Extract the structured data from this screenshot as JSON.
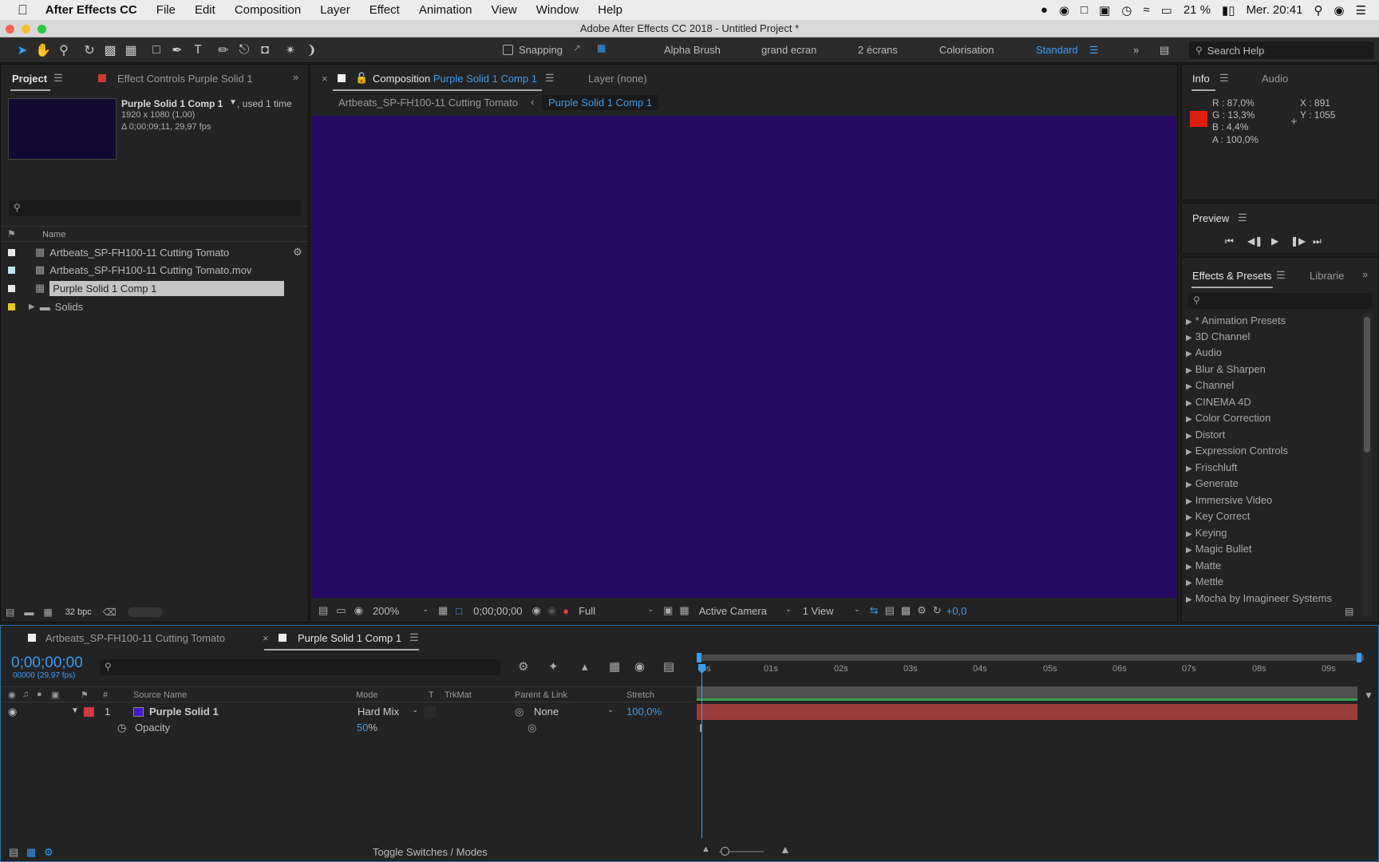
{
  "menubar": {
    "apple": "",
    "app_name": "After Effects CC",
    "items": [
      "File",
      "Edit",
      "Composition",
      "Layer",
      "Effect",
      "Animation",
      "View",
      "Window",
      "Help"
    ],
    "battery": "21 %",
    "clock": "Mer. 20:41"
  },
  "window_title": "Adobe After Effects CC 2018 - Untitled Project *",
  "toolbar": {
    "snapping_label": "Snapping",
    "workspaces": [
      "Alpha Brush",
      "grand ecran",
      "2 écrans",
      "Colorisation",
      "Standard"
    ],
    "search_placeholder": "Search Help"
  },
  "project_panel": {
    "tab_project": "Project",
    "tab_effect_controls": "Effect Controls Purple Solid 1",
    "selected_name": "Purple Solid 1 Comp 1",
    "used": ", used 1 time",
    "dims": "1920 x 1080 (1,00)",
    "duration": "Δ 0;00;09;11, 29,97 fps",
    "column_name": "Name",
    "items": [
      {
        "name": "Artbeats_SP-FH100-11 Cutting Tomato",
        "label_color": "#e8e8e8"
      },
      {
        "name": "Artbeats_SP-FH100-11 Cutting Tomato.mov",
        "label_color": "#bfe6ee"
      },
      {
        "name": "Purple Solid 1 Comp 1",
        "label_color": "#e8e8e8"
      },
      {
        "name": "Solids",
        "label_color": "#e6c71f"
      }
    ],
    "bpc": "32 bpc"
  },
  "comp_panel": {
    "tab_prefix": "Composition",
    "tab_comp": "Purple Solid 1 Comp 1",
    "tab_layer": "Layer (none)",
    "breadcrumb_1": "Artbeats_SP-FH100-11 Cutting Tomato",
    "breadcrumb_2": "Purple Solid 1 Comp 1",
    "viewer_color": "#260a64",
    "zoom": "200%",
    "timecode": "0;00;00;00",
    "resolution": "Full",
    "camera": "Active Camera",
    "views": "1 View",
    "exposure": "+0,0"
  },
  "info_panel": {
    "tab_info": "Info",
    "tab_audio": "Audio",
    "r": "R : 87,0%",
    "g": "G : 13,3%",
    "b": "B : 4,4%",
    "a": "A : 100,0%",
    "x": "X : 891",
    "y": "Y : 1055",
    "swatch": "#de1f10"
  },
  "preview_panel": {
    "title": "Preview"
  },
  "effects_panel": {
    "tab": "Effects & Presets",
    "tab2": "Librarie",
    "items": [
      "* Animation Presets",
      "3D Channel",
      "Audio",
      "Blur & Sharpen",
      "Channel",
      "CINEMA 4D",
      "Color Correction",
      "Distort",
      "Expression Controls",
      "Frischluft",
      "Generate",
      "Immersive Video",
      "Key Correct",
      "Keying",
      "Magic Bullet",
      "Matte",
      "Mettle",
      "Mocha by Imagineer Systems"
    ]
  },
  "timeline": {
    "tab1": "Artbeats_SP-FH100-11 Cutting Tomato",
    "tab2": "Purple Solid 1 Comp 1",
    "timecode": "0;00;00;00",
    "frames": "00000 (29.97 fps)",
    "col_hash": "#",
    "col_source": "Source Name",
    "col_mode": "Mode",
    "col_t": "T",
    "col_trkmat": "TrkMat",
    "col_parent": "Parent & Link",
    "col_stretch": "Stretch",
    "layer_num": "1",
    "layer_name": "Purple Solid 1",
    "layer_mode": "Hard Mix",
    "layer_parent": "None",
    "layer_stretch": "100,0%",
    "opacity_label": "Opacity",
    "opacity_value": "50",
    "opacity_unit": "%",
    "ruler": [
      "0s",
      "01s",
      "02s",
      "03s",
      "04s",
      "05s",
      "06s",
      "07s",
      "08s",
      "09s"
    ],
    "toggle_label": "Toggle Switches / Modes"
  }
}
